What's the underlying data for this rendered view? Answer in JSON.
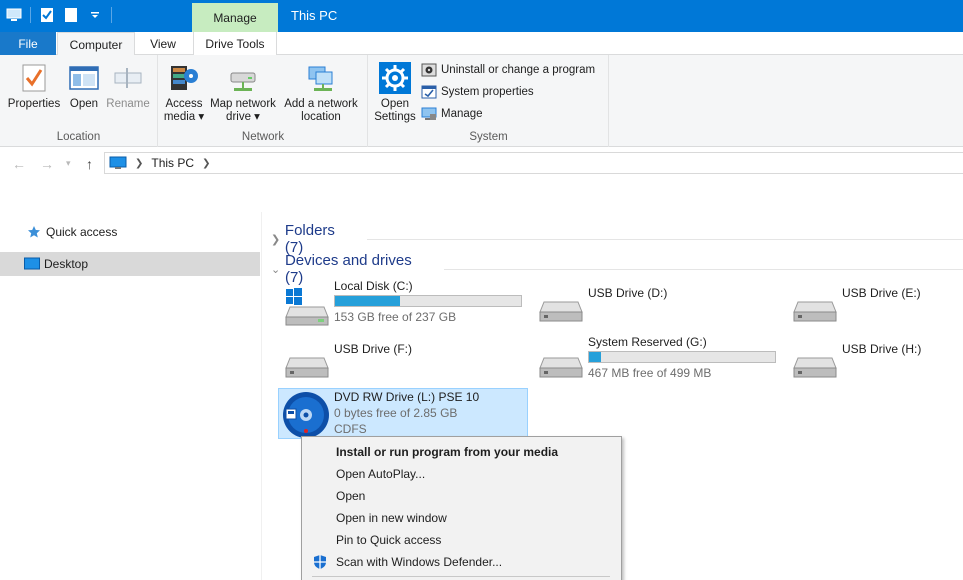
{
  "titlebar": {
    "context_tab": "Manage",
    "window_title": "This PC"
  },
  "ribbon_tabs": {
    "file": "File",
    "computer": "Computer",
    "view": "View",
    "drive_tools": "Drive Tools"
  },
  "ribbon": {
    "location": {
      "label": "Location",
      "properties": "Properties",
      "open": "Open",
      "rename": "Rename"
    },
    "network": {
      "label": "Network",
      "access_media_1": "Access",
      "access_media_2": "media ▾",
      "map_drive_1": "Map network",
      "map_drive_2": "drive ▾",
      "add_location_1": "Add a network",
      "add_location_2": "location"
    },
    "system": {
      "label": "System",
      "open_settings_1": "Open",
      "open_settings_2": "Settings",
      "uninstall": "Uninstall or change a program",
      "system_properties": "System properties",
      "manage": "Manage"
    }
  },
  "address": {
    "crumb": "This PC"
  },
  "nav": {
    "quick_access": "Quick access",
    "desktop": "Desktop"
  },
  "sections": {
    "folders": "Folders (7)",
    "devices": "Devices and drives (7)"
  },
  "drives": {
    "c": {
      "name": "Local Disk (C:)",
      "free": "153 GB free of 237 GB",
      "used_fraction": 0.35
    },
    "d": {
      "name": "USB Drive (D:)"
    },
    "e": {
      "name": "USB Drive (E:)"
    },
    "f": {
      "name": "USB Drive (F:)"
    },
    "g": {
      "name": "System Reserved (G:)",
      "free": "467 MB free of 499 MB",
      "used_fraction": 0.064
    },
    "h": {
      "name": "USB Drive (H:)"
    },
    "l": {
      "name": "DVD RW Drive (L:) PSE 10",
      "free": "0 bytes free of 2.85 GB",
      "fs": "CDFS"
    }
  },
  "context_menu": {
    "install": "Install or run program from your media",
    "autoplay": "Open AutoPlay...",
    "open": "Open",
    "open_new_window": "Open in new window",
    "pin_quick_access": "Pin to Quick access",
    "scan_defender": "Scan with Windows Defender..."
  },
  "colors": {
    "accent": "#0078d7",
    "manage_tab": "#c7ecc0",
    "selection": "#cce8ff",
    "bar_fill": "#26a0da"
  }
}
